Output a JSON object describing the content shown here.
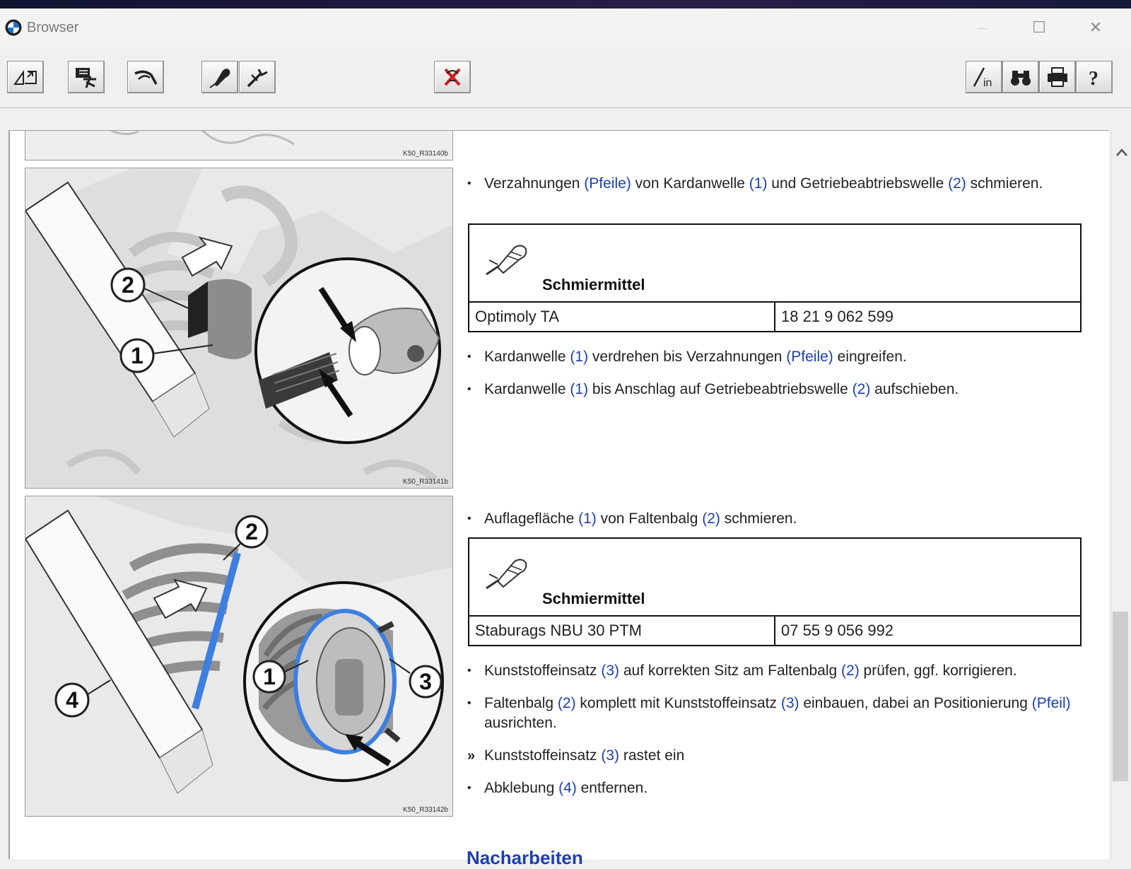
{
  "window": {
    "title": "Browser",
    "minimize": "—",
    "maximize": "☐",
    "close": "✕"
  },
  "toolbar": {
    "left_icons": [
      "back-arrow-icon",
      "document-tools-icon",
      "tool-pliers-icon",
      "lubricant-icon",
      "wrench-icon"
    ],
    "center_icon": "close-tools-icon",
    "right_icons": [
      "info-icon",
      "binoculars-icon",
      "print-icon",
      "help-icon"
    ],
    "info_label": "in",
    "help_label": "?"
  },
  "figures": [
    {
      "code": "K50_R33140b"
    },
    {
      "code": "K50_R33141b",
      "callouts": [
        "2",
        "1"
      ]
    },
    {
      "code": "K50_R33142b",
      "callouts": [
        "2",
        "4",
        "1",
        "3"
      ]
    }
  ],
  "steps": {
    "s1": {
      "bullet": "•",
      "t1": "Verzahnungen ",
      "r1": "(Pfeile)",
      "t2": " von Kardanwelle ",
      "r2": "(1)",
      "t3": " und Getriebeabtriebswelle ",
      "r3": "(2)",
      "t4": " schmieren."
    },
    "s2": {
      "bullet": "•",
      "t1": "Kardanwelle ",
      "r1": "(1)",
      "t2": " verdrehen bis Verzahnungen ",
      "r2": "(Pfeile)",
      "t3": " eingreifen."
    },
    "s3": {
      "bullet": "•",
      "t1": "Kardanwelle ",
      "r1": "(1)",
      "t2": " bis Anschlag auf Getriebeabtriebswelle ",
      "r2": "(2)",
      "t3": " aufschieben."
    },
    "s4": {
      "bullet": "•",
      "t1": "Auflagefläche ",
      "r1": "(1)",
      "t2": " von Faltenbalg ",
      "r2": "(2)",
      "t3": " schmieren."
    },
    "s5": {
      "bullet": "•",
      "t1": "Kunststoffeinsatz ",
      "r1": "(3)",
      "t2": " auf korrekten Sitz am Faltenbalg ",
      "r2": "(2)",
      "t3": " prüfen, ggf. korrigieren."
    },
    "s6": {
      "bullet": "•",
      "t1": "Faltenbalg ",
      "r1": "(2)",
      "t2": " komplett mit Kunststoffeinsatz ",
      "r2": "(3)",
      "t3": " einbauen, dabei an Positionierung ",
      "r3": "(Pfeil)",
      "t4": " ausrichten."
    },
    "s7": {
      "bullet": "»",
      "t1": "Kunststoffeinsatz ",
      "r1": "(3)",
      "t2": " rastet ein"
    },
    "s8": {
      "bullet": "•",
      "t1": "Abklebung ",
      "r1": "(4)",
      "t2": " entfernen."
    }
  },
  "lubricants": [
    {
      "title": "Schmiermittel",
      "name": "Optimoly TA",
      "part_no": "18 21 9 062 599"
    },
    {
      "title": "Schmiermittel",
      "name": "Staburags NBU 30 PTM",
      "part_no": "07 55 9 056 992"
    }
  ],
  "next_heading": "Nacharbeiten",
  "colors": {
    "link": "#1d3fb0",
    "highlight_blue": "#3d7ee0"
  }
}
